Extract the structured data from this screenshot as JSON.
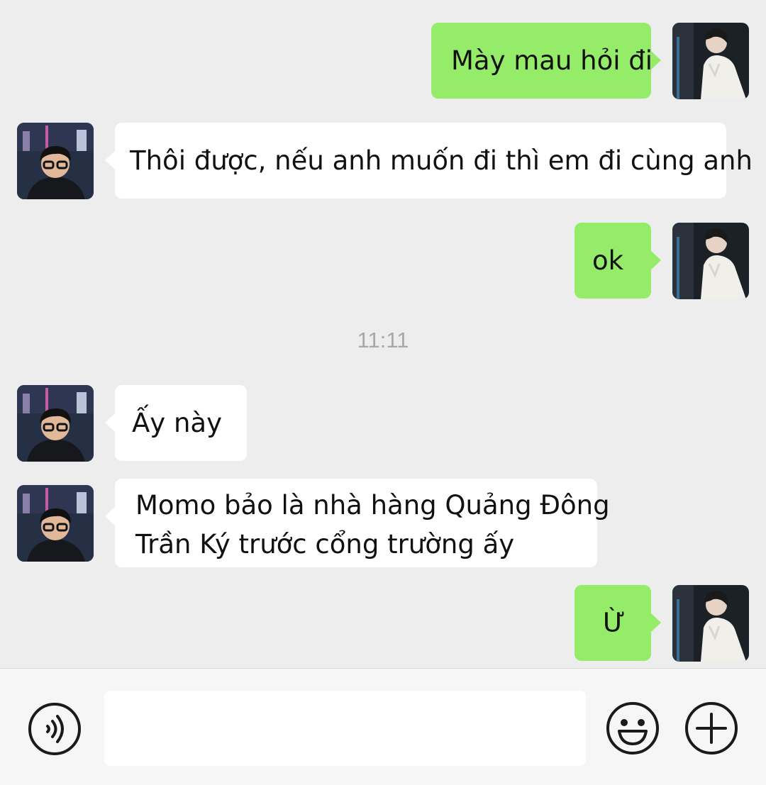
{
  "messages": [
    {
      "side": "out",
      "text": "Mày mau hỏi đi"
    },
    {
      "side": "in",
      "text": "Thôi được, nếu anh muốn đi thì em đi cùng anh"
    },
    {
      "side": "out",
      "text": "ok"
    },
    {
      "side": "in",
      "text": "Ấy này"
    },
    {
      "side": "in",
      "lines": [
        "Momo bảo là nhà hàng Quảng Đông",
        "Trần Ký trước cổng trường ấy"
      ]
    },
    {
      "side": "out",
      "text": "Ừ"
    }
  ],
  "timestamp": "11:11",
  "input": {
    "value": "",
    "placeholder": ""
  },
  "icons": {
    "voice": "voice-icon",
    "emoji": "emoji-icon",
    "add": "plus-icon",
    "self_avatar": "avatar-self",
    "contact_avatar": "avatar-contact"
  },
  "colors": {
    "background": "#ededed",
    "outgoing_bubble": "#95ec69",
    "incoming_bubble": "#ffffff",
    "timestamp_text": "#a8a8a8",
    "input_bar": "#f6f6f6"
  }
}
